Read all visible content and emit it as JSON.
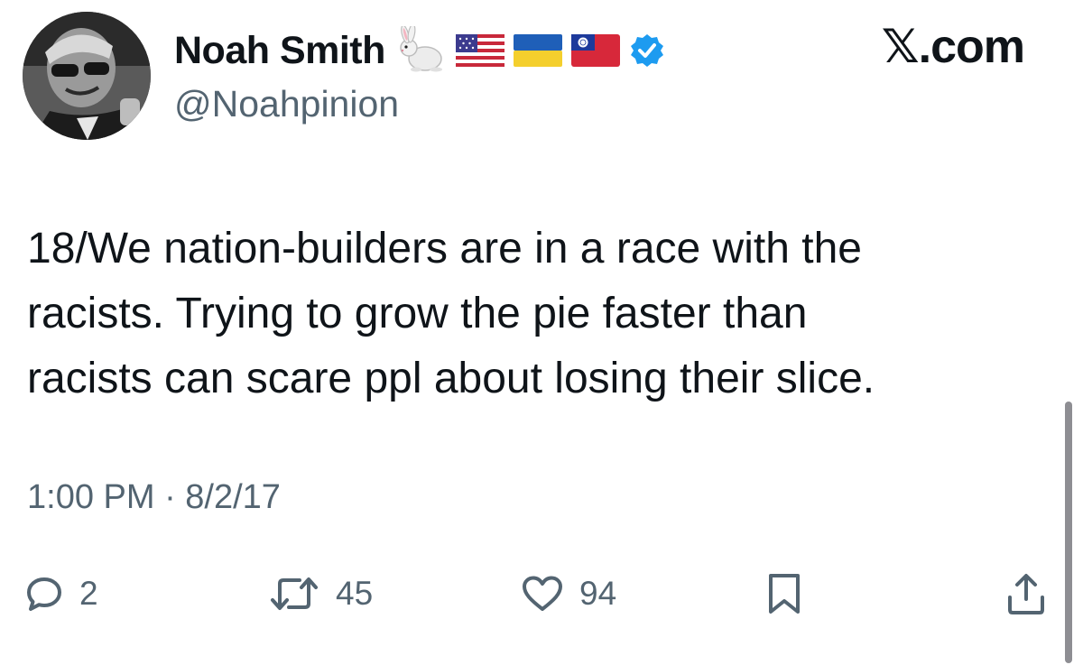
{
  "tweet": {
    "author": {
      "display_name": "Noah Smith",
      "handle": "@Noahpinion",
      "name_emojis": [
        "rabbit-emoji",
        "us-flag-emoji",
        "ukraine-flag-emoji",
        "taiwan-flag-emoji"
      ],
      "verified": true
    },
    "text_lines": [
      "18/We nation-builders are in a race with the",
      "racists. Trying to grow the pie faster than",
      "racists can scare ppl about losing their slice."
    ],
    "timestamp": "1:00 PM · 8/2/17",
    "actions": {
      "replies": "2",
      "reposts": "45",
      "likes": "94"
    }
  },
  "brand": {
    "label": "𝕏.com"
  },
  "colors": {
    "text": "#0f1419",
    "secondary": "#536471",
    "verified": "#1d9bf0"
  },
  "icons": [
    "reply-icon",
    "repost-icon",
    "like-icon",
    "bookmark-icon",
    "share-icon",
    "verified-badge-icon"
  ]
}
